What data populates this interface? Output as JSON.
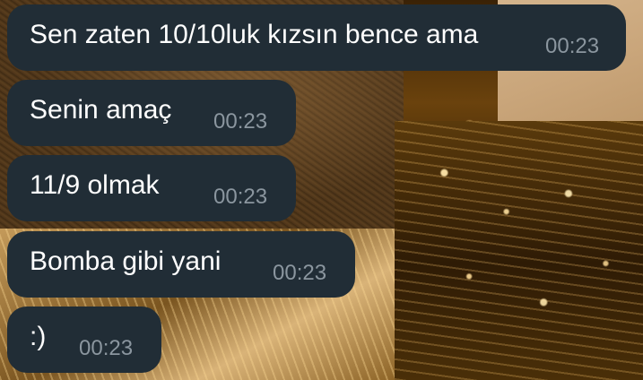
{
  "chat": {
    "messages": [
      {
        "text": "Sen zaten 10/10luk kızsın bence ama",
        "time": "00:23"
      },
      {
        "text": "Senin amaç",
        "time": "00:23"
      },
      {
        "text": "11/9 olmak",
        "time": "00:23"
      },
      {
        "text": "Bomba gibi yani",
        "time": "00:23"
      },
      {
        "text": ":)",
        "time": "00:23"
      }
    ]
  },
  "colors": {
    "bubble_bg": "#212d36",
    "message_text": "#ffffff",
    "timestamp_text": "#8b969f"
  }
}
